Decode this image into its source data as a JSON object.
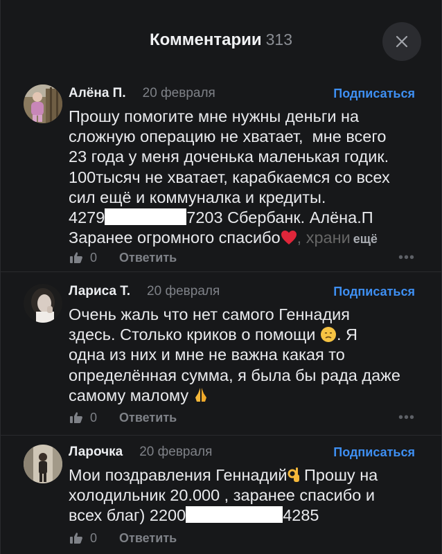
{
  "header": {
    "title": "Комментарии",
    "count": "313"
  },
  "comments": [
    {
      "author": "Алёна П.",
      "date": "20 февраля",
      "subscribe": "Подписаться",
      "lines": [
        "Прошу помогите мне нужны деньги на",
        "сложную операцию не хватает,  мне всего",
        "23 года у меня доченька маленькая годик.",
        "100тысяч не хватает, карабкаемся со всех",
        "сил ещё и коммуналка и кредиты."
      ],
      "card_prefix": "4279",
      "card_suffix": "7203 Сбербанк. Алёна.П",
      "last_line": "Заранее огромного спасибо",
      "last_line_tail": ", храни",
      "more": "ещё",
      "likes": "0",
      "reply": "Ответить"
    },
    {
      "author": "Лариса Т.",
      "date": "20 февраля",
      "subscribe": "Подписаться",
      "lines": [
        "Очень жаль что нет самого Геннадия",
        "здесь. Столько криков о помощи",
        "одна из них и мне не важна какая то",
        "определённая сумма, я была бы рада даже",
        "самому малому"
      ],
      "line2_tail": ". Я",
      "likes": "0",
      "reply": "Ответить"
    },
    {
      "author": "Ларочка",
      "date": "20 февраля",
      "subscribe": "Подписаться",
      "lines": [
        "Мои поздравления Геннадий",
        "холодильник 20.000 , заранее спасибо и"
      ],
      "line1_tail": " Прошу на",
      "card_prefix": "всех благ) 2200",
      "card_suffix": "4285",
      "likes": "0",
      "reply": "Ответить"
    }
  ]
}
